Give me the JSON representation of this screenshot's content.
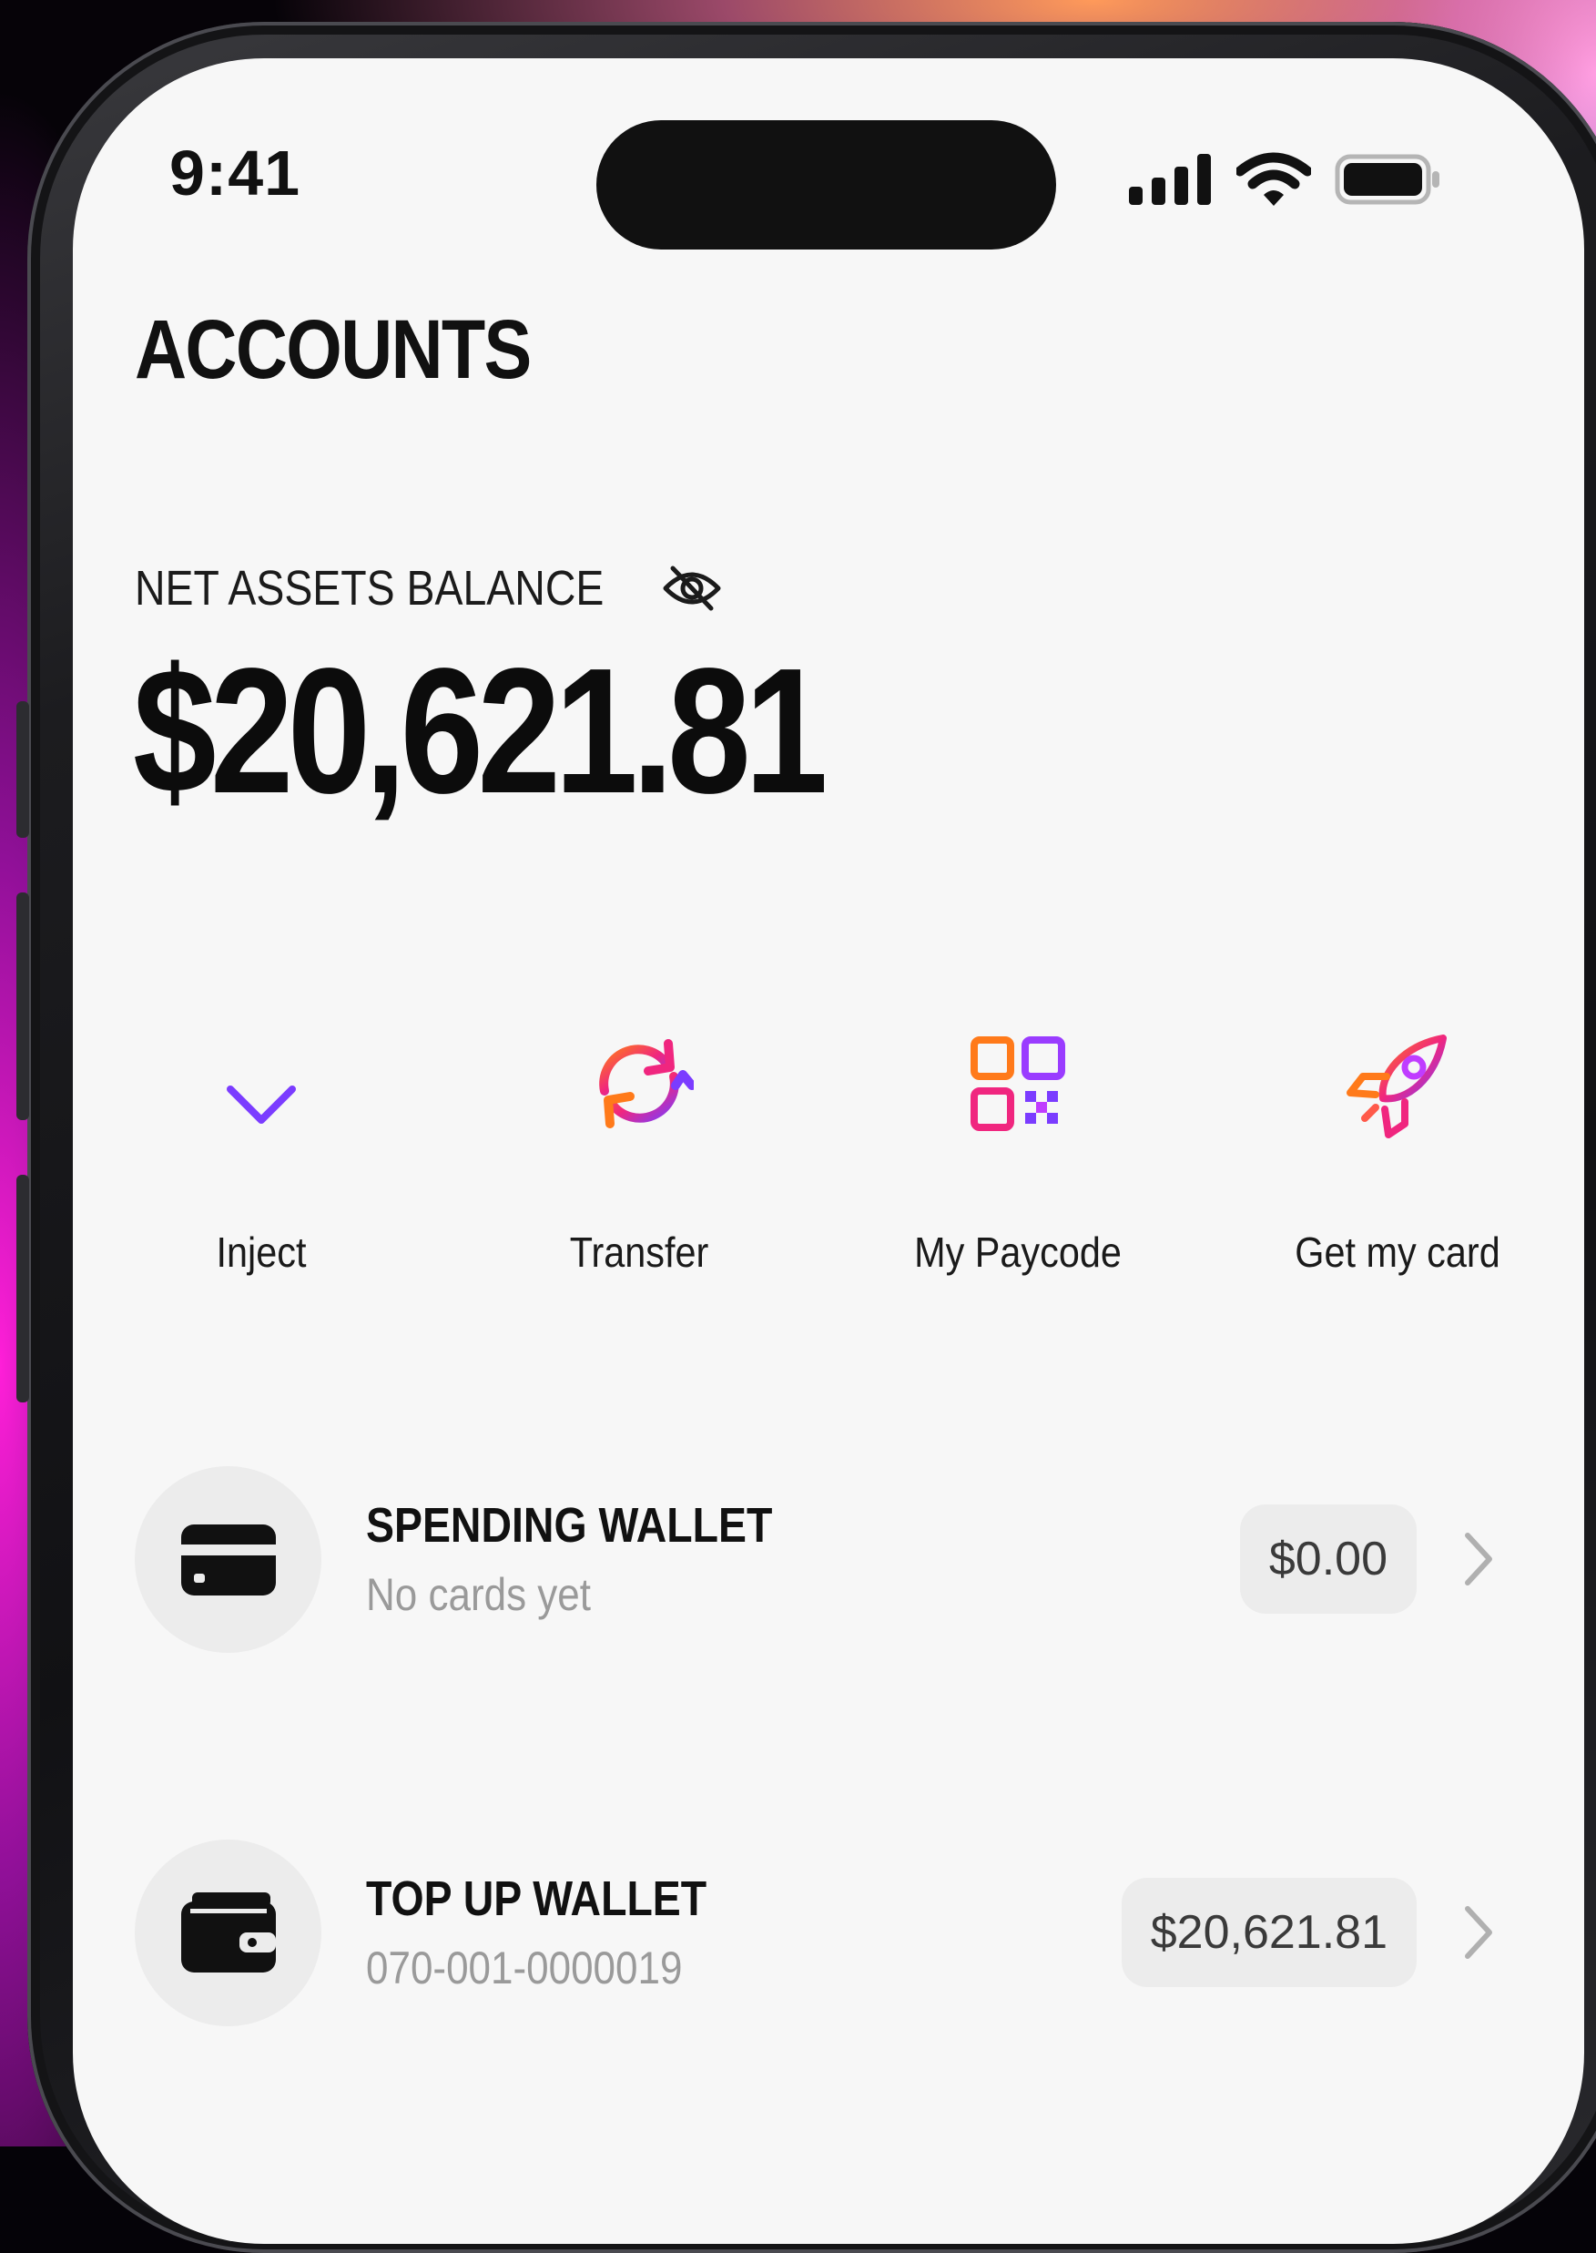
{
  "status_bar": {
    "time": "9:41"
  },
  "header": {
    "title": "ACCOUNTS"
  },
  "balance": {
    "label": "NET ASSETS BALANCE",
    "amount": "$20,621.81",
    "visibility_icon": "eye-off-icon"
  },
  "actions": [
    {
      "label": "Inject",
      "icon": "arrow-down-icon"
    },
    {
      "label": "Transfer",
      "icon": "refresh-icon"
    },
    {
      "label": "My Paycode",
      "icon": "qr-code-icon"
    },
    {
      "label": "Get my card",
      "icon": "rocket-icon"
    }
  ],
  "wallets": [
    {
      "title": "SPENDING WALLET",
      "subtitle": "No cards yet",
      "amount": "$0.00",
      "icon": "credit-card-icon"
    },
    {
      "title": "TOP UP WALLET",
      "subtitle": "070-001-0000019",
      "amount": "$20,621.81",
      "icon": "wallet-icon"
    }
  ],
  "colors": {
    "gradient_orange": "#ff7a1a",
    "gradient_pink": "#f0267f",
    "gradient_purple": "#7b3cff",
    "screen_background": "#f7f7f7",
    "pill_background": "#ececec",
    "subtitle_gray": "#9a9a9a"
  }
}
